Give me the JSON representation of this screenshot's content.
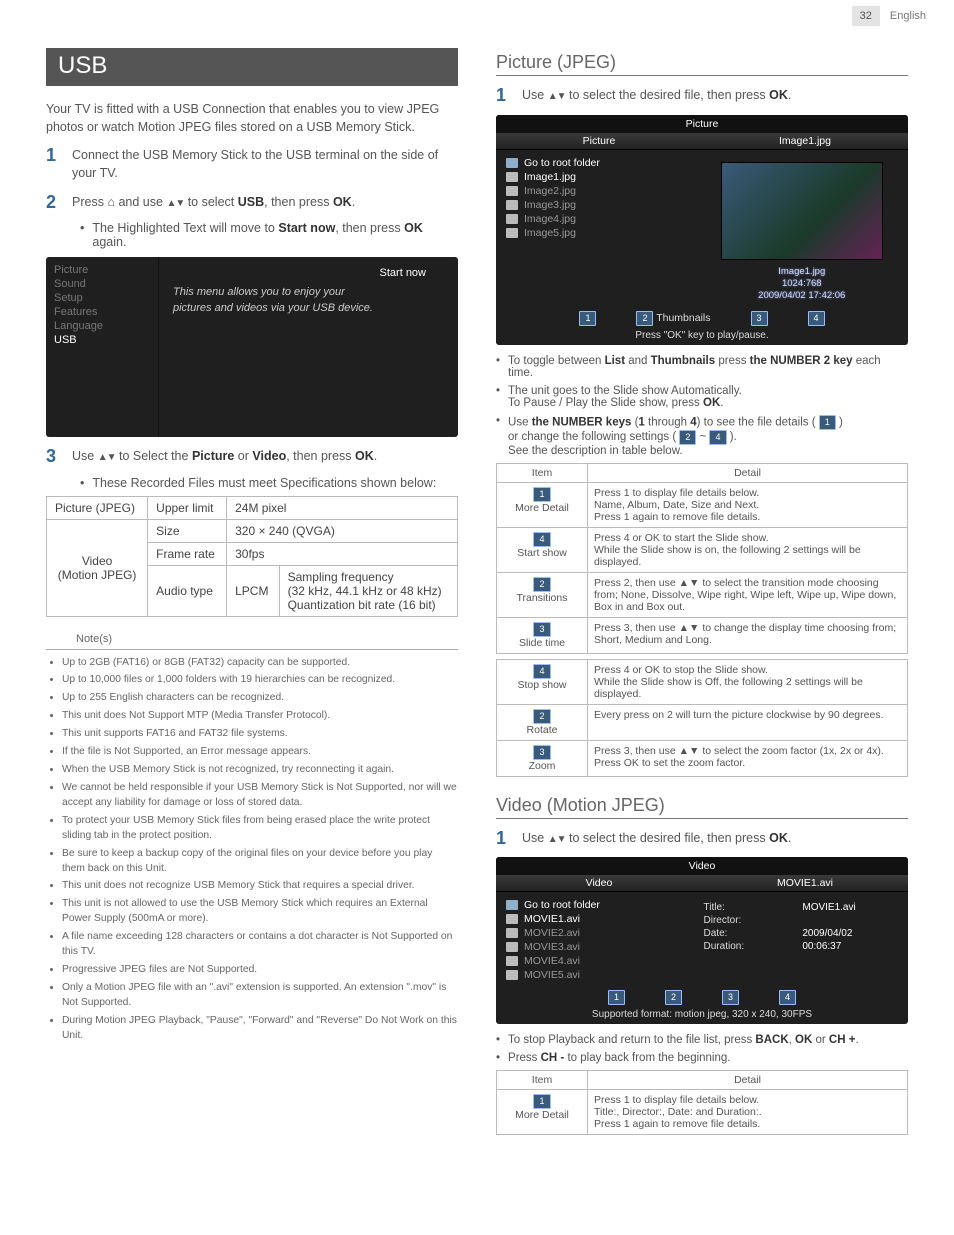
{
  "header": {
    "page": "32",
    "lang": "English"
  },
  "usb": {
    "title": "USB",
    "intro": "Your TV is fitted with a USB Connection that enables you to view JPEG photos or watch Motion JPEG files stored on a USB Memory Stick.",
    "step1": "Connect the USB Memory Stick to the USB terminal on the side of your TV.",
    "step2_a": "Press ",
    "step2_b": " and use ",
    "step2_c": " to select ",
    "step2_usb": "USB",
    "step2_d": ", then press ",
    "step2_ok": "OK",
    "step2_e": ".",
    "step2_sub_a": "The Highlighted Text will move to ",
    "step2_sub_sn": "Start now",
    "step2_sub_b": ", then press ",
    "step2_sub_ok": "OK",
    "step2_sub_c": " again.",
    "osd": {
      "menu": [
        "Picture",
        "Sound",
        "Setup",
        "Features",
        "Language",
        "USB"
      ],
      "startnow": "Start now",
      "msg": "This menu allows you to enjoy your pictures and videos via your USB device."
    },
    "step3_a": "Use ",
    "step3_b": " to Select the ",
    "step3_pic": "Picture",
    "step3_c": " or ",
    "step3_vid": "Video",
    "step3_d": ", then press ",
    "step3_ok": "OK",
    "step3_e": ".",
    "step3_sub": "These Recorded Files must meet Specifications shown below:",
    "spec": {
      "r1c1": "Picture (JPEG)",
      "r1c2": "Upper limit",
      "r1c3": "24M pixel",
      "r2c1": "Video\n(Motion JPEG)",
      "r2c2": "Size",
      "r2c3": "320 × 240 (QVGA)",
      "r3c2": "Frame rate",
      "r3c3": "30fps",
      "r4c2": "Audio type",
      "r4c3a": "LPCM",
      "r4c3b": "Sampling frequency\n(32 kHz, 44.1 kHz or 48 kHz)\nQuantization bit rate (16 bit)"
    },
    "notes_h": "Note(s)",
    "notes": [
      "Up to 2GB (FAT16) or 8GB (FAT32) capacity can be supported.",
      "Up to 10,000 files or 1,000 folders with 19 hierarchies can be recognized.",
      "Up to 255 English characters can be recognized.",
      "This unit does Not Support MTP (Media Transfer Protocol).",
      "This unit supports FAT16 and FAT32 file systems.",
      "If the file is Not Supported, an Error message appears.",
      "When the USB Memory Stick is not recognized, try reconnecting it again.",
      "We cannot be held responsible if your USB Memory Stick is Not Supported, nor will we accept any liability for damage or loss of stored data.",
      "To protect your USB Memory Stick files from being erased place the write protect sliding tab in the protect position.",
      "Be sure to keep a backup copy of the original files on your device before you play them back on this Unit.",
      "This unit does not recognize USB Memory Stick that requires a special driver.",
      "This unit is not allowed to use the USB Memory Stick which requires an External Power Supply (500mA or more).",
      "A file name exceeding 128 characters or contains a dot character is Not Supported on this TV.",
      "Progressive JPEG files are Not Supported.",
      "Only a Motion JPEG file with an \".avi\" extension is supported. An extension \".mov\" is Not Supported.",
      "During Motion JPEG Playback, \"Pause\", \"Forward\" and \"Reverse\" Do Not Work on this Unit."
    ]
  },
  "picture": {
    "title": "Picture (JPEG)",
    "step1_a": "Use ",
    "step1_b": " to select the desired file, then press ",
    "step1_ok": "OK",
    "step1_c": ".",
    "osd": {
      "top": "Picture",
      "colL": "Picture",
      "colR": "Image1.jpg",
      "root": "Go to root folder",
      "files": [
        "Image1.jpg",
        "Image2.jpg",
        "Image3.jpg",
        "Image4.jpg",
        "Image5.jpg"
      ],
      "cap1": "Image1.jpg",
      "cap2": "1024:768",
      "cap3": "2009/04/02  17:42:06",
      "thumbs": "Thumbnails",
      "foot": "Press \"OK\" key to play/pause."
    },
    "bul1_a": "To toggle between ",
    "bul1_b": "List",
    "bul1_c": " and ",
    "bul1_d": "Thumbnails",
    "bul1_e": " press ",
    "bul1_f": "the NUMBER 2 key",
    "bul1_g": " each time.",
    "bul2_a": "The unit goes to the Slide show Automatically.",
    "bul2_b": "To Pause / Play the Slide show, press ",
    "bul2_ok": "OK",
    "bul2_c": ".",
    "bul3_a": "Use ",
    "bul3_b": "the NUMBER keys",
    "bul3_c": " (",
    "bul3_d": "1",
    "bul3_e": " through ",
    "bul3_f": "4",
    "bul3_g": ") to see the file details ( ",
    "bul3_h": "or change the following settings ( ",
    "bul3_i": " ~ ",
    "bul3_j": " ).",
    "bul3_k": "See the description in table below.",
    "table": {
      "h1": "Item",
      "h2": "Detail",
      "r1i": "More Detail",
      "r1d": "Press 1 to display file details below.\nName, Album, Date, Size and Next.\nPress 1 again to remove file details.",
      "r2i": "Start show",
      "r2d": "Press 4 or OK to start the Slide show.\nWhile the Slide show is on, the following 2 settings will be displayed.",
      "r3i": "Transitions",
      "r3d": "Press 2, then use ▲▼ to select the transition mode choosing from; None, Dissolve, Wipe right, Wipe left, Wipe up, Wipe down, Box in and Box out.",
      "r4i": "Slide time",
      "r4d": "Press 3, then use ▲▼ to change the display time choosing from; Short, Medium and Long.",
      "r5i": "Stop show",
      "r5d": "Press 4 or OK to stop the Slide show.\nWhile the Slide show is Off, the following 2 settings will be displayed.",
      "r6i": "Rotate",
      "r6d": "Every press on 2 will turn the picture clockwise by 90 degrees.",
      "r7i": "Zoom",
      "r7d": "Press 3, then use ▲▼ to select the zoom factor (1x, 2x or 4x). Press OK to set the zoom factor."
    }
  },
  "video": {
    "title": "Video (Motion JPEG)",
    "step1_a": "Use ",
    "step1_b": " to select the desired file, then press ",
    "step1_ok": "OK",
    "step1_c": ".",
    "osd": {
      "top": "Video",
      "colL": "Video",
      "colR": "MOVIE1.avi",
      "root": "Go to root folder",
      "files": [
        "MOVIE1.avi",
        "MOVIE2.avi",
        "MOVIE3.avi",
        "MOVIE4.avi",
        "MOVIE5.avi"
      ],
      "meta": {
        "Title:": "MOVIE1.avi",
        "Director:": "",
        "Date:": "2009/04/02",
        "Duration:": "00:06:37"
      },
      "foot": "Supported format: motion jpeg, 320 x 240, 30FPS"
    },
    "bul1_a": "To stop Playback and return to the file list, press ",
    "bul1_b": "BACK",
    "bul1_c": ", ",
    "bul1_d": "OK",
    "bul1_e": " or ",
    "bul1_f": "CH +",
    "bul1_g": ".",
    "bul2_a": "Press ",
    "bul2_b": "CH -",
    "bul2_c": " to play back from the beginning.",
    "table": {
      "h1": "Item",
      "h2": "Detail",
      "r1i": "More Detail",
      "r1d": "Press 1 to display file details below.\nTitle:, Director:, Date: and Duration:.\nPress 1 again to remove file details."
    }
  }
}
